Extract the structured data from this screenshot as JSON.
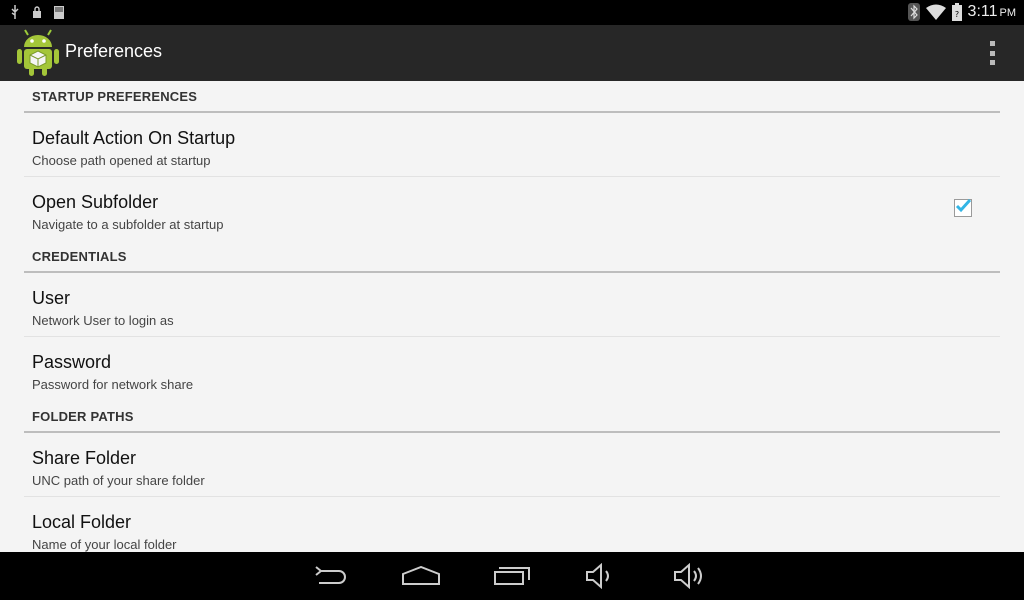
{
  "status_bar": {
    "time": "3:11",
    "ampm": "PM",
    "left_icons": [
      "usb-icon",
      "lock-icon",
      "sd-card-icon"
    ],
    "right_icons": [
      "bluetooth-icon",
      "wifi-icon",
      "battery-icon"
    ]
  },
  "action_bar": {
    "title": "Preferences",
    "app_icon": "android-app-icon",
    "overflow_icon": "overflow-menu-icon"
  },
  "sections": [
    {
      "header": "STARTUP PREFERENCES",
      "items": [
        {
          "title": "Default Action On Startup",
          "summary": "Choose path opened at startup"
        },
        {
          "title": "Open Subfolder",
          "summary": "Navigate to a subfolder at startup",
          "checked": true
        }
      ]
    },
    {
      "header": "CREDENTIALS",
      "items": [
        {
          "title": "User",
          "summary": "Network User to login as"
        },
        {
          "title": "Password",
          "summary": "Password for network share"
        }
      ]
    },
    {
      "header": "FOLDER PATHS",
      "items": [
        {
          "title": "Share Folder",
          "summary": "UNC path of your share folder"
        },
        {
          "title": "Local Folder",
          "summary": "Name of your local folder"
        }
      ]
    }
  ],
  "nav_bar": {
    "buttons": [
      "back-icon",
      "home-icon",
      "recent-apps-icon",
      "volume-down-icon",
      "volume-up-icon"
    ]
  },
  "colors": {
    "status_bar": "#000000",
    "action_bar": "#272727",
    "content_bg": "#f4f4f4",
    "accent": "#33b5e5",
    "divider": "#bdbdbd"
  }
}
